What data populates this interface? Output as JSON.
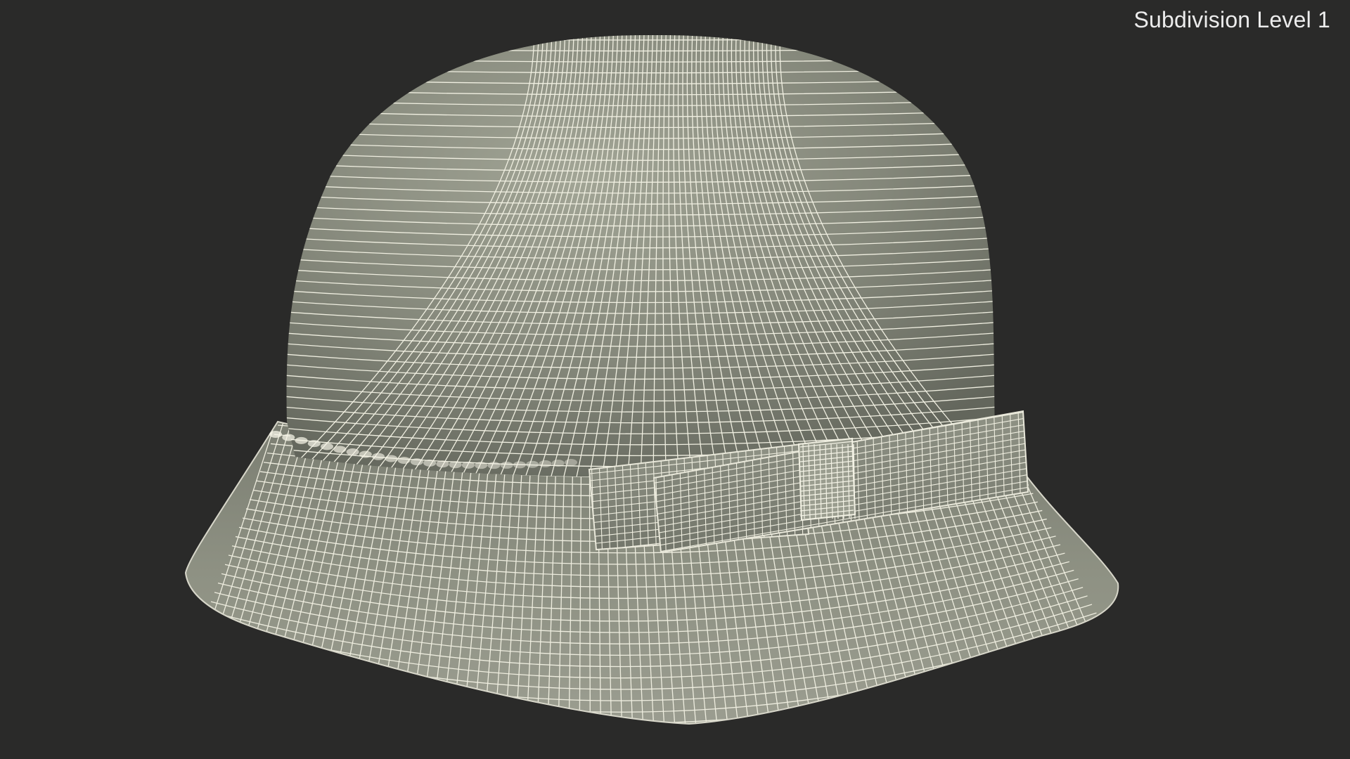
{
  "viewport": {
    "label": "Subdivision Level 1",
    "background_color": "#2a2a29"
  },
  "model": {
    "name_icon": "bucket-hat-wireframe",
    "surface_color": "#84877a",
    "surface_light": "#a4a697",
    "surface_dark": "#5e6157",
    "wire_color": "#f2f1e4",
    "band_highlight": "#f7f5e8"
  }
}
